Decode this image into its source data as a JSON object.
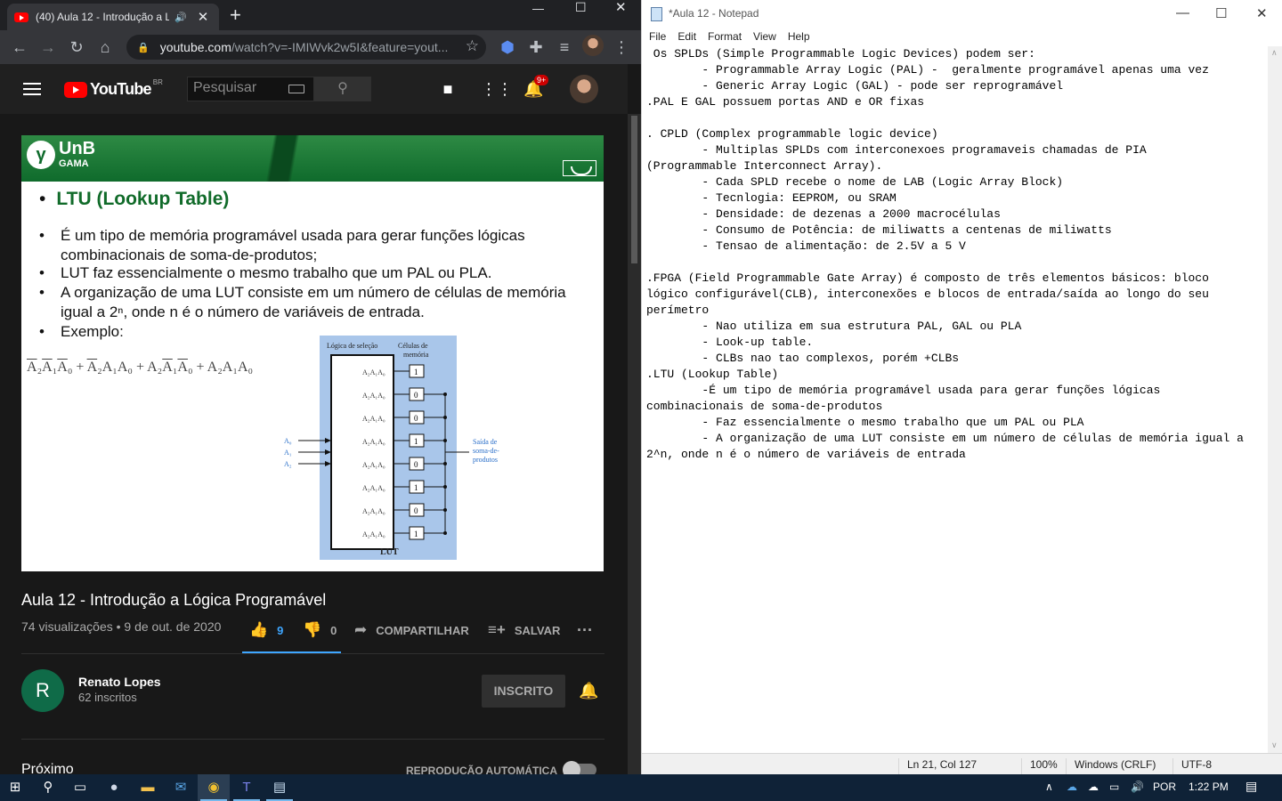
{
  "browser": {
    "tab_title": "(40) Aula 12 - Introdução a L",
    "url_host": "youtube.com",
    "url_rest": "/watch?v=-IMIWvk2w5I&feature=yout...",
    "notif_count": "9+"
  },
  "youtube": {
    "logo_word": "YouTube",
    "logo_country": "BR",
    "search_placeholder": "Pesquisar",
    "slide": {
      "logo_name": "UnB",
      "logo_sub": "GAMA",
      "heading": "LTU (Lookup Table)",
      "bullets": [
        "É um tipo de memória programável usada para gerar funções lógicas combinacionais de soma-de-produtos;",
        "LUT faz essencialmente o mesmo trabalho que um PAL ou PLA.",
        "A organização de uma LUT consiste em um número de células de memória igual a 2ⁿ, onde n é o número de variáveis de entrada.",
        "Exemplo:"
      ],
      "figure": {
        "header_left": "Lógica de seleção",
        "header_right": "Células de memória",
        "cells": [
          "1",
          "0",
          "0",
          "1",
          "0",
          "1",
          "0",
          "1"
        ],
        "inputs": [
          "A₀",
          "A₁",
          "A₂"
        ],
        "output": "Saída de soma-de-produtos",
        "label": "LUT"
      }
    },
    "video_title": "Aula 12 - Introdução a Lógica Programável",
    "video_meta": "74 visualizações • 9 de out. de 2020",
    "likes": "9",
    "dislikes": "0",
    "share_label": "COMPARTILHAR",
    "save_label": "SALVAR",
    "channel_initial": "R",
    "channel_name": "Renato Lopes",
    "channel_subs": "62 inscritos",
    "subscribed_label": "INSCRITO",
    "next_label": "Próximo",
    "autoplay_label": "REPRODUÇÃO AUTOMÁTICA"
  },
  "notepad": {
    "title": "*Aula 12 - Notepad",
    "menu": [
      "File",
      "Edit",
      "Format",
      "View",
      "Help"
    ],
    "lines": [
      " Os SPLDs (Simple Programmable Logic Devices) podem ser:",
      "        - Programmable Array Logic (PAL) -  geralmente programável apenas uma vez",
      "        - Generic Array Logic (GAL) - pode ser reprogramável",
      ".PAL E GAL possuem portas AND e OR fixas",
      "",
      ". CPLD (Complex programmable logic device)",
      "        - Multiplas SPLDs com interconexoes programaveis chamadas de PIA",
      "(Programmable Interconnect Array).",
      "        - Cada SPLD recebe o nome de LAB (Logic Array Block)",
      "        - Tecnlogia: EEPROM, ou SRAM",
      "        - Densidade: de dezenas a 2000 macrocélulas",
      "        - Consumo de Potência: de miliwatts a centenas de miliwatts",
      "        - Tensao de alimentação: de 2.5V a 5 V",
      "",
      ".FPGA (Field Programmable Gate Array) é composto de três elementos básicos: bloco",
      "lógico configurável(CLB), interconexões e blocos de entrada/saída ao longo do seu",
      "perímetro",
      "        - Nao utiliza em sua estrutura PAL, GAL ou PLA",
      "        - Look-up table.",
      "        - CLBs nao tao complexos, porém +CLBs",
      ".LTU (Lookup Table)",
      "        -É um tipo de memória programável usada para gerar funções lógicas",
      "combinacionais de soma-de-produtos",
      "        - Faz essencialmente o mesmo trabalho que um PAL ou PLA",
      "        - A organização de uma LUT consiste em um número de células de memória igual a",
      "2^n, onde n é o número de variáveis de entrada"
    ],
    "status": {
      "position": "Ln 21, Col 127",
      "zoom": "100%",
      "line_ending": "Windows (CRLF)",
      "encoding": "UTF-8"
    }
  },
  "taskbar": {
    "language": "POR",
    "time": "1:22 PM"
  }
}
